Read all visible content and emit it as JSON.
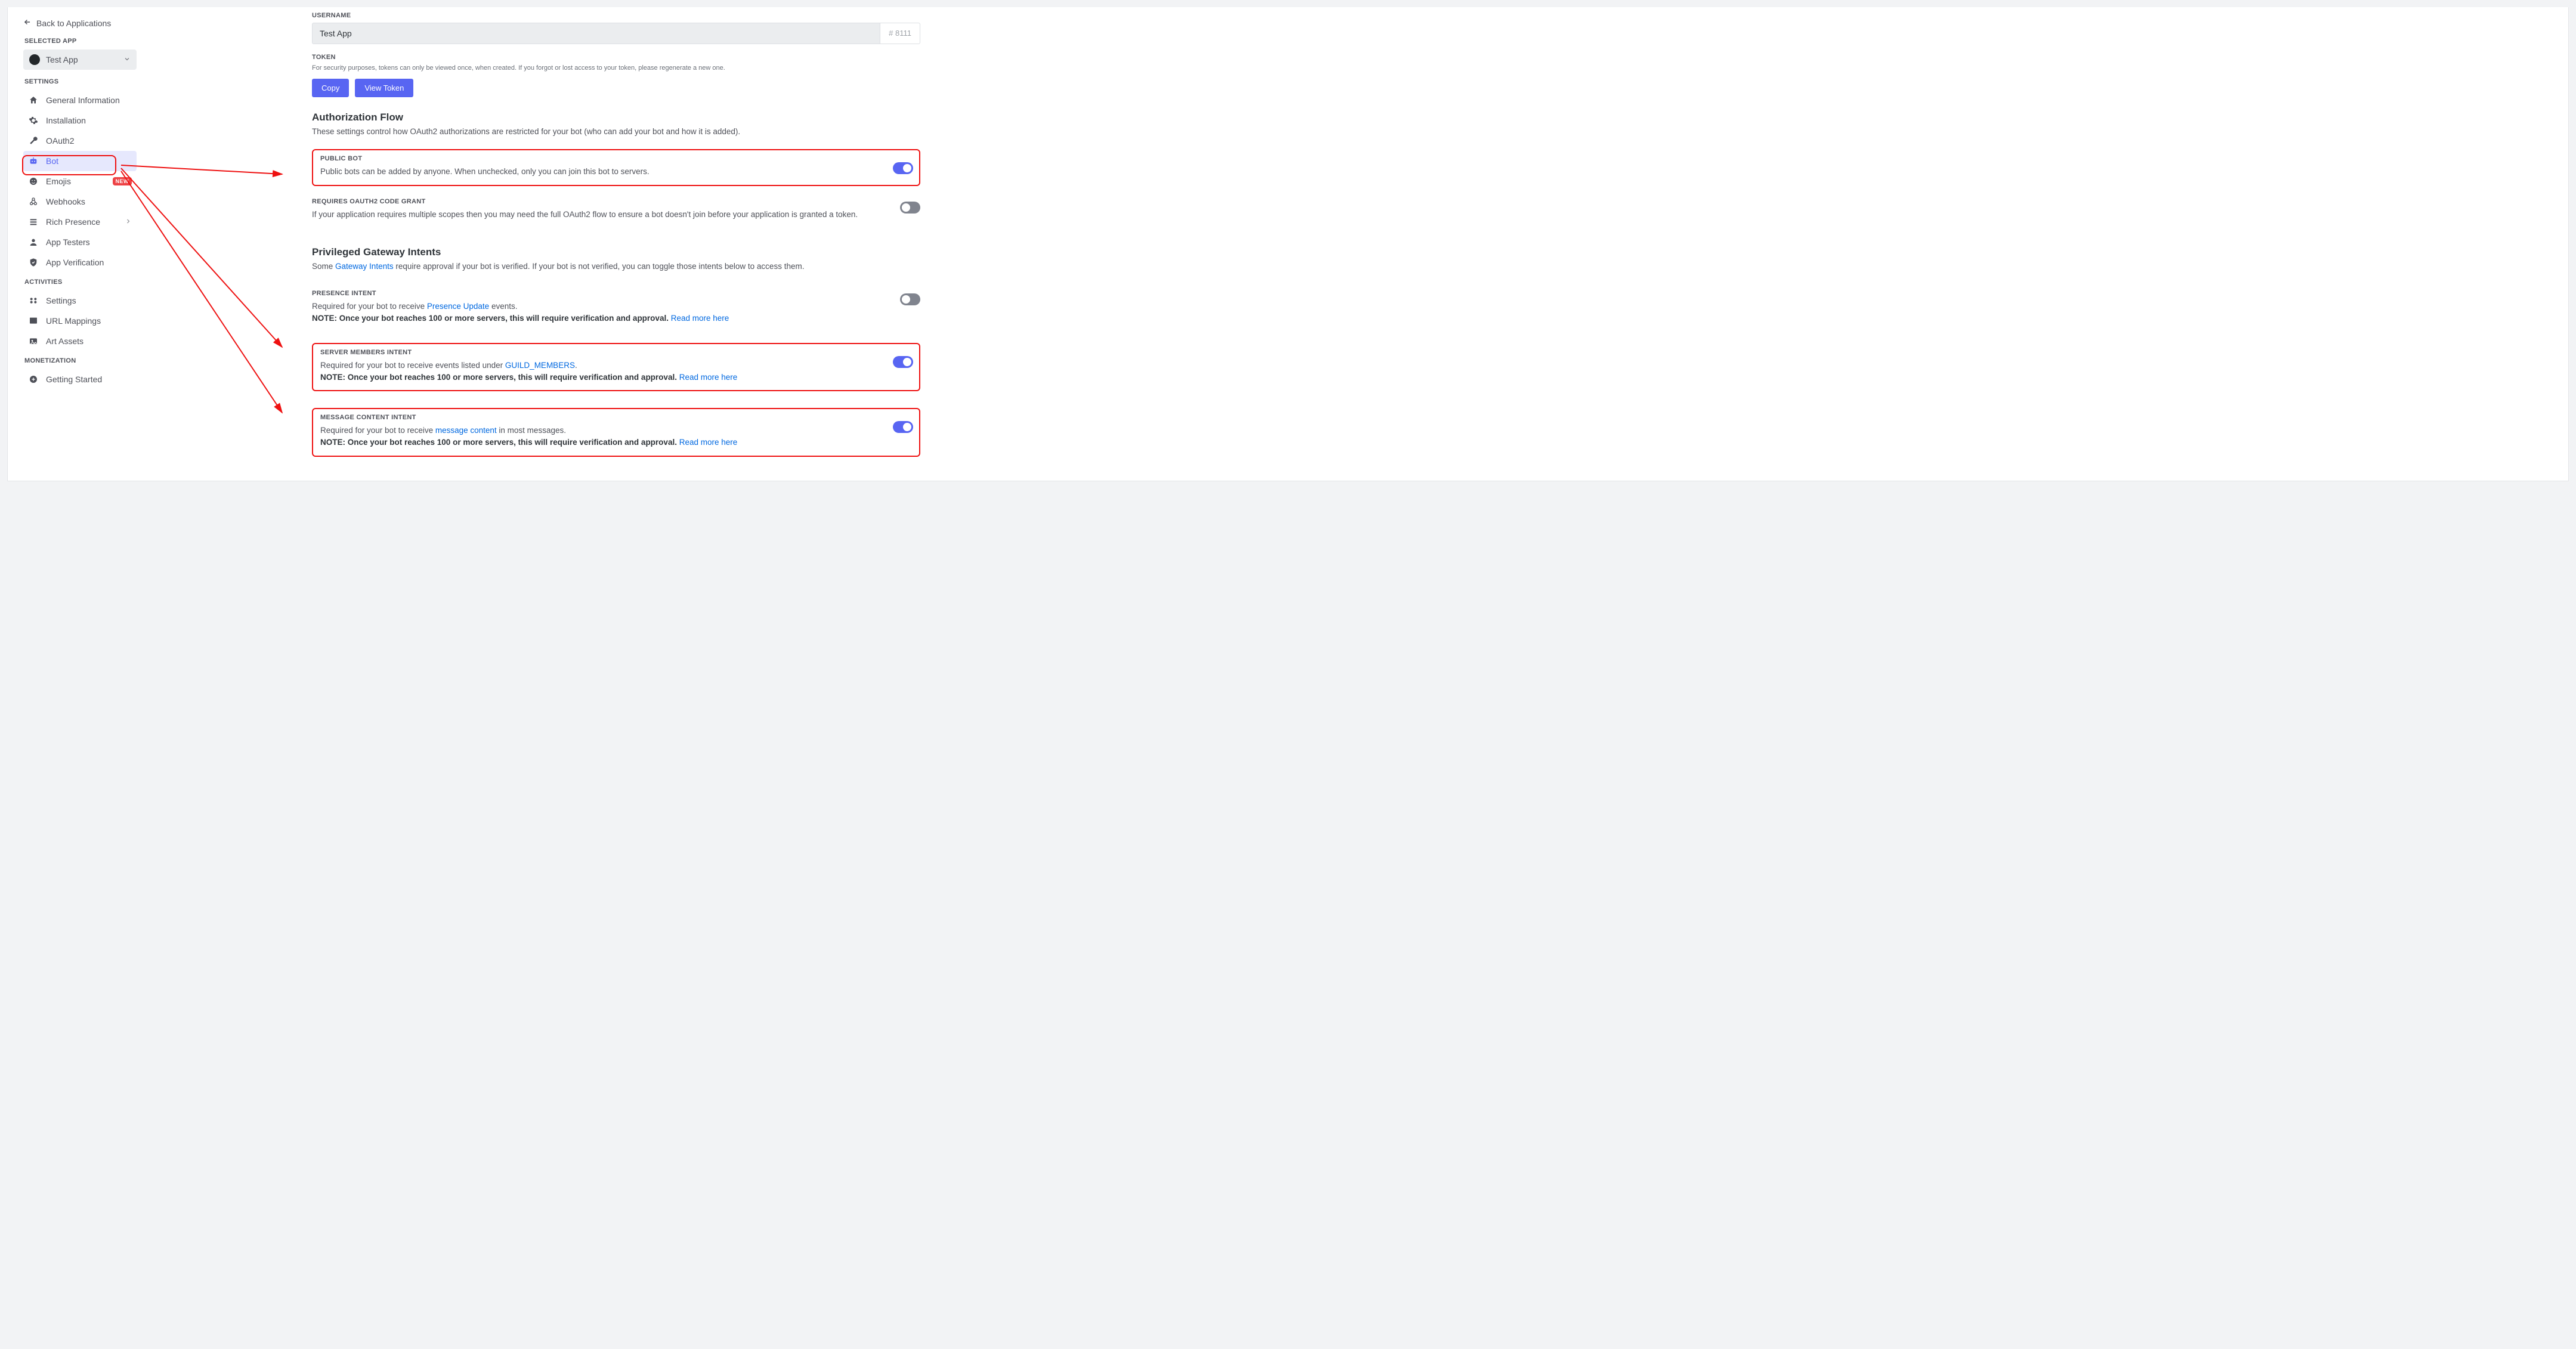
{
  "sidebar": {
    "back_label": "Back to Applications",
    "selected_app_label": "SELECTED APP",
    "app_name": "Test App",
    "settings_label": "SETTINGS",
    "activities_label": "ACTIVITIES",
    "monetization_label": "MONETIZATION",
    "items": {
      "general": "General Information",
      "installation": "Installation",
      "oauth2": "OAuth2",
      "bot": "Bot",
      "emojis": "Emojis",
      "emojis_badge": "NEW",
      "webhooks": "Webhooks",
      "rich_presence": "Rich Presence",
      "app_testers": "App Testers",
      "app_verification": "App Verification",
      "act_settings": "Settings",
      "url_mappings": "URL Mappings",
      "art_assets": "Art Assets",
      "getting_started": "Getting Started"
    }
  },
  "main": {
    "username_label": "USERNAME",
    "username_value": "Test App",
    "username_tag": "# 8111",
    "token_label": "TOKEN",
    "token_hint": "For security purposes, tokens can only be viewed once, when created. If you forgot or lost access to your token, please regenerate a new one.",
    "copy_btn": "Copy",
    "view_token_btn": "View Token",
    "auth_flow_title": "Authorization Flow",
    "auth_flow_desc": "These settings control how OAuth2 authorizations are restricted for your bot (who can add your bot and how it is added).",
    "public_bot": {
      "head": "PUBLIC BOT",
      "desc": "Public bots can be added by anyone. When unchecked, only you can join this bot to servers."
    },
    "requires_oauth": {
      "head": "REQUIRES OAUTH2 CODE GRANT",
      "desc": "If your application requires multiple scopes then you may need the full OAuth2 flow to ensure a bot doesn't join before your application is granted a token."
    },
    "gateway_title": "Privileged Gateway Intents",
    "gateway_desc_pre": "Some ",
    "gateway_link": "Gateway Intents",
    "gateway_desc_post": " require approval if your bot is verified. If your bot is not verified, you can toggle those intents below to access them.",
    "presence": {
      "head": "PRESENCE INTENT",
      "desc_pre": "Required for your bot to receive ",
      "link": "Presence Update",
      "desc_post": " events.",
      "note_pre": "NOTE: Once your bot reaches 100 or more servers, this will require verification and approval. ",
      "note_link": "Read more here"
    },
    "members": {
      "head": "SERVER MEMBERS INTENT",
      "desc_pre": "Required for your bot to receive events listed under ",
      "link": "GUILD_MEMBERS",
      "desc_post": ".",
      "note_pre": "NOTE: Once your bot reaches 100 or more servers, this will require verification and approval. ",
      "note_link": "Read more here"
    },
    "message": {
      "head": "MESSAGE CONTENT INTENT",
      "desc_pre": "Required for your bot to receive ",
      "link": "message content",
      "desc_post": " in most messages.",
      "note_pre": "NOTE: Once your bot reaches 100 or more servers, this will require verification and approval. ",
      "note_link": "Read more here"
    }
  }
}
